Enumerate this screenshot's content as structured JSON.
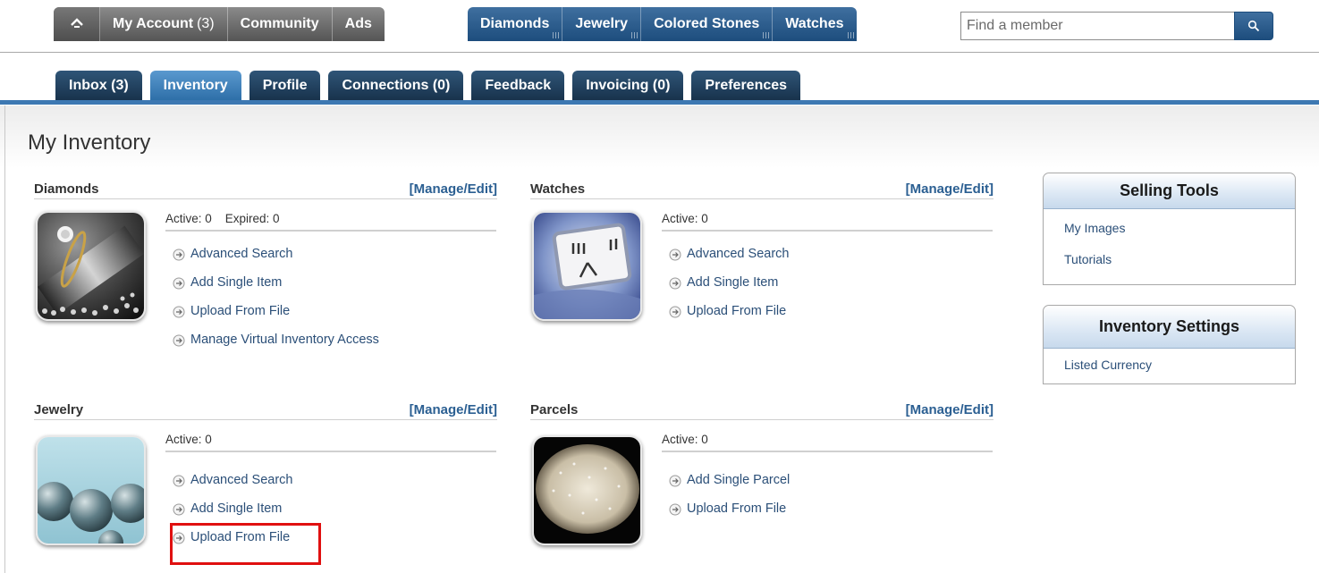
{
  "topnav": {
    "account_tabs": [
      {
        "label": "My Account",
        "count": "(3)"
      },
      {
        "label": "Community"
      },
      {
        "label": "Ads"
      }
    ],
    "market_tabs": [
      {
        "label": "Diamonds"
      },
      {
        "label": "Jewelry"
      },
      {
        "label": "Colored Stones"
      },
      {
        "label": "Watches"
      }
    ],
    "search_placeholder": "Find a member"
  },
  "subnav": {
    "tabs": [
      {
        "label": "Inbox (3)"
      },
      {
        "label": "Inventory"
      },
      {
        "label": "Profile"
      },
      {
        "label": "Connections (0)"
      },
      {
        "label": "Feedback"
      },
      {
        "label": "Invoicing (0)"
      },
      {
        "label": "Preferences"
      }
    ],
    "active": "Inventory"
  },
  "page": {
    "title": "My Inventory",
    "sections": {
      "diamonds": {
        "title": "Diamonds",
        "manage": "[Manage/Edit]",
        "status": "Active: 0    Expired: 0",
        "links": [
          "Advanced Search",
          "Add Single Item",
          "Upload From File",
          "Manage Virtual Inventory Access"
        ]
      },
      "watches": {
        "title": "Watches",
        "manage": "[Manage/Edit]",
        "status": "Active: 0",
        "links": [
          "Advanced Search",
          "Add Single Item",
          "Upload From File"
        ]
      },
      "jewelry": {
        "title": "Jewelry",
        "manage": "[Manage/Edit]",
        "status": "Active: 0",
        "links": [
          "Advanced Search",
          "Add Single Item",
          "Upload From File"
        ]
      },
      "parcels": {
        "title": "Parcels",
        "manage": "[Manage/Edit]",
        "status": "Active: 0",
        "links": [
          "Add Single Parcel",
          "Upload From File"
        ]
      }
    }
  },
  "sidebar": {
    "selling_tools": {
      "title": "Selling Tools",
      "links": [
        "My Images",
        "Tutorials"
      ]
    },
    "inventory_settings": {
      "title": "Inventory Settings",
      "links": [
        "Listed Currency"
      ]
    }
  },
  "colors": {
    "market_nav": "#2a5a8a",
    "account_nav": "#666666",
    "active_subtab": "#3e80bb",
    "link": "#2b4f78",
    "highlight": "#e01010"
  },
  "icons": [
    "home-icon",
    "search-icon",
    "circle-arrow-icon"
  ]
}
